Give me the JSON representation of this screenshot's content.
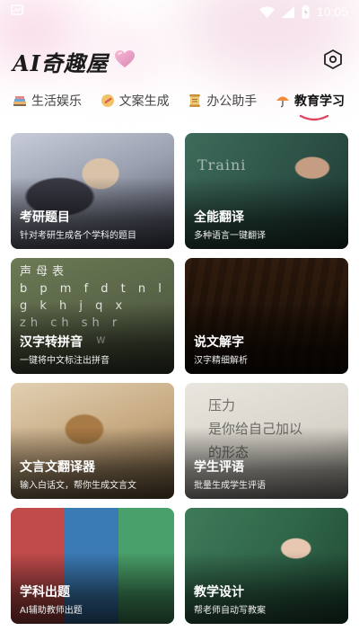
{
  "status_bar": {
    "time": "10:05",
    "icons": [
      "notification-icon",
      "wifi-icon",
      "signal-icon",
      "battery-icon"
    ]
  },
  "header": {
    "title": "AI奇趣屋",
    "settings_icon": "hexagon-settings-icon"
  },
  "tabs": [
    {
      "label": "生活娱乐",
      "icon": "books-icon",
      "active": false
    },
    {
      "label": "文案生成",
      "icon": "pen-badge-icon",
      "active": false
    },
    {
      "label": "办公助手",
      "icon": "scroll-icon",
      "active": false
    },
    {
      "label": "教育学习",
      "icon": "umbrella-icon",
      "active": true
    }
  ],
  "cards": [
    {
      "title": "考研题目",
      "desc": "针对考研生成各个学科的题目"
    },
    {
      "title": "全能翻译",
      "desc": "多种语言一键翻译",
      "board_text": "Traini"
    },
    {
      "title": "汉字转拼音",
      "desc": "一键将中文标注出拼音",
      "image_text": "声母表\nb p m f d t n l\ng k h j q x\nzh ch sh r\nz c s y w"
    },
    {
      "title": "说文解字",
      "desc": "汉字精细解析"
    },
    {
      "title": "文言文翻译器",
      "desc": "输入白话文，帮你生成文言文"
    },
    {
      "title": "学生评语",
      "desc": "批量生成学生评语",
      "image_text": "压力\n是你给自己加以\n的形态"
    },
    {
      "title": "学科出题",
      "desc": "AI辅助教师出题"
    },
    {
      "title": "教学设计",
      "desc": "帮老师自动写教案"
    }
  ],
  "colors": {
    "accent": "#e0455f",
    "text_primary": "#111111",
    "text_secondary": "#444444"
  }
}
